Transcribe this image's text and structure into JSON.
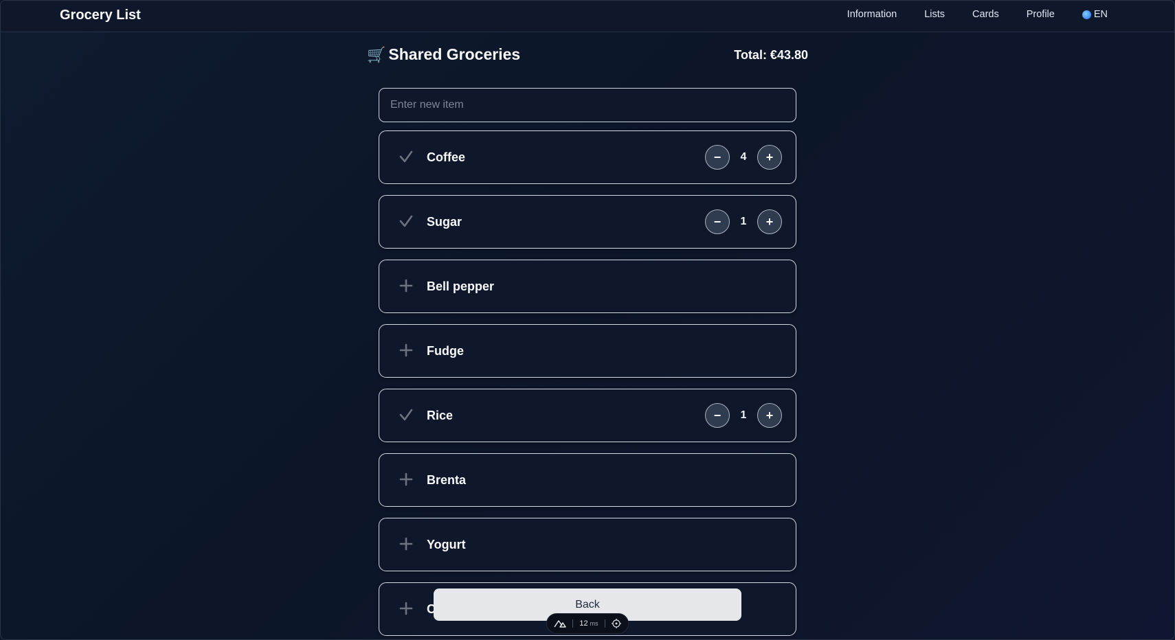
{
  "navbar": {
    "brand": "Grocery List",
    "links": [
      "Information",
      "Lists",
      "Cards",
      "Profile"
    ],
    "language": "EN",
    "language_icon": "globe-icon"
  },
  "header": {
    "icon": "🛒",
    "title": "Shared Groceries",
    "total": "Total: €43.80"
  },
  "new_item": {
    "placeholder": "Enter new item",
    "value": ""
  },
  "items": [
    {
      "name": "Coffee",
      "status": "checked",
      "status_icon": "checkmark-icon",
      "quantity": "4"
    },
    {
      "name": "Sugar",
      "status": "checked",
      "status_icon": "checkmark-icon",
      "quantity": "1"
    },
    {
      "name": "Bell pepper",
      "status": "unchecked",
      "status_icon": "plus-icon"
    },
    {
      "name": "Fudge",
      "status": "unchecked",
      "status_icon": "plus-icon"
    },
    {
      "name": "Rice",
      "status": "checked",
      "status_icon": "checkmark-icon",
      "quantity": "1"
    },
    {
      "name": "Brenta",
      "status": "unchecked",
      "status_icon": "plus-icon"
    },
    {
      "name": "Yogurt",
      "status": "unchecked",
      "status_icon": "plus-icon"
    },
    {
      "name": "C",
      "status": "unchecked",
      "status_icon": "plus-icon"
    }
  ],
  "qty_controls": {
    "decrement": "−",
    "increment": "+"
  },
  "back_button": "Back",
  "devtools": {
    "timing": "12",
    "unit": "ms"
  },
  "colors": {
    "background": "#0f172a",
    "card_border": "#d4dae3",
    "button_bg": "#2f3b4f",
    "back_button_bg": "#e5e7eb",
    "muted_icon": "#6b7280"
  }
}
